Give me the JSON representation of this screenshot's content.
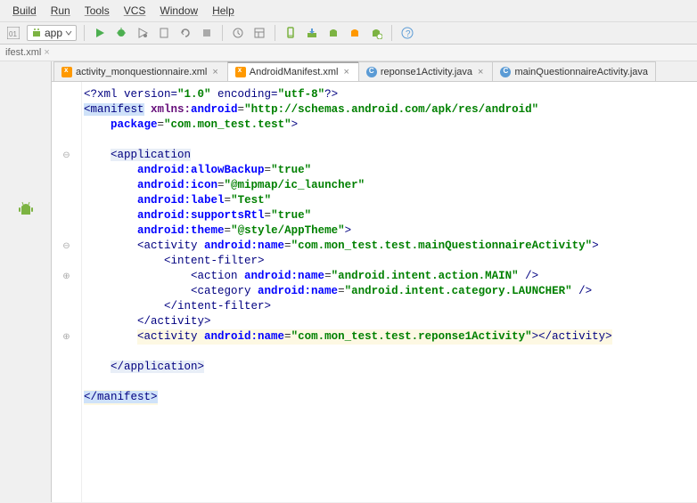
{
  "menubar": {
    "build": "Build",
    "run": "Run",
    "tools": "Tools",
    "vcs": "VCS",
    "window": "Window",
    "help": "Help"
  },
  "toolbar": {
    "app_selector": "app"
  },
  "breadcrumb": "ifest.xml",
  "tabs": [
    {
      "label": "activity_monquestionnaire.xml",
      "type": "xml",
      "active": false
    },
    {
      "label": "AndroidManifest.xml",
      "type": "xml",
      "active": true
    },
    {
      "label": "reponse1Activity.java",
      "type": "java",
      "active": false
    },
    {
      "label": "mainQuestionnaireActivity.java",
      "type": "java",
      "active": false,
      "noclose": true
    }
  ],
  "code": {
    "prolog_pre": "<?xml version=",
    "prolog_ver": "\"1.0\"",
    "prolog_mid": " encoding=",
    "prolog_enc": "\"utf-8\"",
    "prolog_end": "?>",
    "manifest_open": "<manifest",
    "xmlns_k": " xmlns:",
    "xmlns_n": "android",
    "xmlns_eq": "=",
    "xmlns_v": "\"http://schemas.android.com/apk/res/android\"",
    "package_k": "package",
    "package_v": "\"com.mon_test.test\"",
    "close": ">",
    "application_open": "<application",
    "allowBackup_k": "android:allowBackup",
    "allowBackup_v": "\"true\"",
    "icon_k": "android:icon",
    "icon_v": "\"@mipmap/ic_launcher\"",
    "label_k": "android:label",
    "label_v": "\"Test\"",
    "supportsRtl_k": "android:supportsRtl",
    "supportsRtl_v": "\"true\"",
    "theme_k": "android:theme",
    "theme_v": "\"@style/AppTheme\"",
    "activity_open": "<activity ",
    "name_k": "android:name",
    "act1_v": "\"com.mon_test.test.mainQuestionnaireActivity\"",
    "intent_open": "<intent-filter>",
    "action_open": "<action ",
    "action_v": "\"android.intent.action.MAIN\"",
    "selfclose": " />",
    "category_open": "<category ",
    "category_v": "\"android.intent.category.LAUNCHER\"",
    "intent_close": "</intent-filter>",
    "activity_close": "</activity>",
    "act2_v": "\"com.mon_test.test.reponse1Activity\"",
    "application_close": "</application>",
    "manifest_close": "</manifest>"
  }
}
